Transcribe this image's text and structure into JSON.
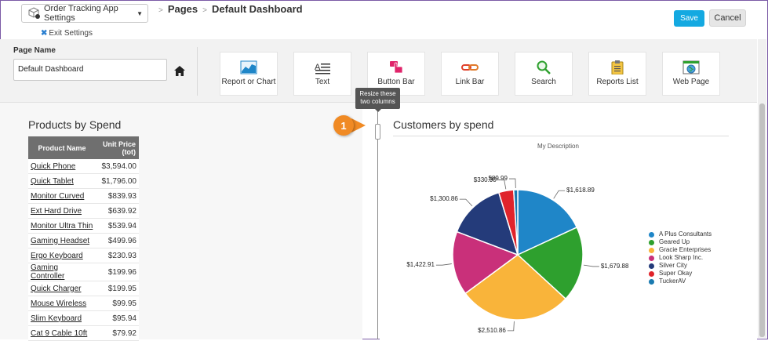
{
  "header": {
    "app_selector": "Order Tracking App Settings",
    "exit_label": "Exit Settings",
    "crumb_pages": "Pages",
    "crumb_sep": ">",
    "crumb_current": "Default Dashboard",
    "save": "Save",
    "cancel": "Cancel"
  },
  "page_name": {
    "label": "Page Name",
    "value": "Default Dashboard"
  },
  "tools": [
    {
      "label": "Report or Chart",
      "icon": "line-chart-icon"
    },
    {
      "label": "Text",
      "icon": "text-icon"
    },
    {
      "label": "Button Bar",
      "icon": "touch-button-icon"
    },
    {
      "label": "Link Bar",
      "icon": "chain-link-icon"
    },
    {
      "label": "Search",
      "icon": "magnifier-icon"
    },
    {
      "label": "Reports List",
      "icon": "clipboard-icon"
    },
    {
      "label": "Web Page",
      "icon": "globe-window-icon"
    }
  ],
  "tooltip": {
    "line1": "Resize these",
    "line2": "two columns"
  },
  "callout": {
    "number": "1"
  },
  "left": {
    "title": "Products by Spend",
    "columns": [
      "Product Name",
      "Unit Price",
      "(tot)"
    ],
    "rows": [
      {
        "name": "Quick Phone",
        "price": "$3,594.00"
      },
      {
        "name": "Quick Tablet",
        "price": "$1,796.00"
      },
      {
        "name": "Monitor Curved",
        "price": "$839.93"
      },
      {
        "name": "Ext Hard Drive",
        "price": "$639.92"
      },
      {
        "name": "Monitor Ultra Thin",
        "price": "$539.94"
      },
      {
        "name": "Gaming Headset",
        "price": "$499.96"
      },
      {
        "name": "Ergo Keyboard",
        "price": "$230.93"
      },
      {
        "name": "Gaming Controller",
        "price": "$199.96"
      },
      {
        "name": "Quick Charger",
        "price": "$199.95"
      },
      {
        "name": "Mouse Wireless",
        "price": "$99.95"
      },
      {
        "name": "Slim Keyboard",
        "price": "$95.94"
      },
      {
        "name": "Cat 9 Cable 10ft",
        "price": "$79.92"
      }
    ]
  },
  "right": {
    "title": "Customers by spend",
    "description": "My Description"
  },
  "colors": {
    "accent": "#14a9e1",
    "callout": "#f08a24"
  },
  "chart_data": {
    "type": "pie",
    "title": "",
    "subtitle": "My Description",
    "legend_position": "right",
    "slices": [
      {
        "name": "A Plus Consultants",
        "value": 1618.89,
        "label": "$1,618.89",
        "color": "#1f86c8"
      },
      {
        "name": "Geared Up",
        "value": 1679.88,
        "label": "$1,679.88",
        "color": "#2ea02e"
      },
      {
        "name": "Gracie Enterprises",
        "value": 2510.86,
        "label": "$2,510.86",
        "color": "#f9b43a"
      },
      {
        "name": "Look Sharp Inc.",
        "value": 1422.91,
        "label": "$1,422.91",
        "color": "#c9307a"
      },
      {
        "name": "Silver City",
        "value": 1300.86,
        "label": "$1,300.86",
        "color": "#243b7a"
      },
      {
        "name": "Super Okay",
        "value": 330.9,
        "label": "$330.90",
        "color": "#e0242b"
      },
      {
        "name": "TuckerAV",
        "value": 89.99,
        "label": "$89.99",
        "color": "#1a7ab0"
      }
    ]
  }
}
